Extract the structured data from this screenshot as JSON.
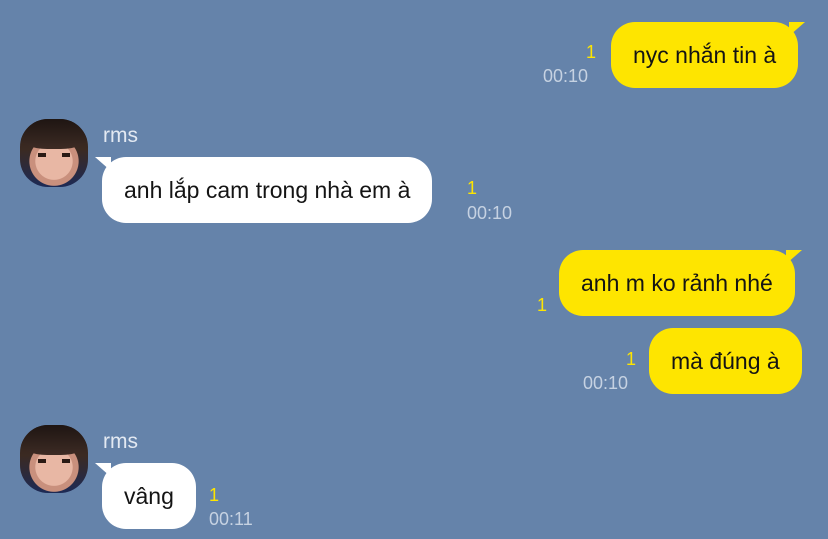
{
  "messages": [
    {
      "text": "nyc nhắn tin à",
      "unread": "1",
      "time": "00:10"
    },
    {
      "sender": "rms",
      "text": "anh lắp cam trong nhà em à",
      "unread": "1",
      "time": "00:10"
    },
    {
      "text": "anh m ko rảnh nhé",
      "unread": "1"
    },
    {
      "text": "mà đúng à",
      "unread": "1",
      "time": "00:10"
    },
    {
      "sender": "rms",
      "text": "vâng",
      "unread": "1",
      "time": "00:11"
    }
  ],
  "colors": {
    "background": "#6583aa",
    "outgoing_bubble": "#fee500",
    "incoming_bubble": "#ffffff",
    "unread_count": "#fee500"
  }
}
